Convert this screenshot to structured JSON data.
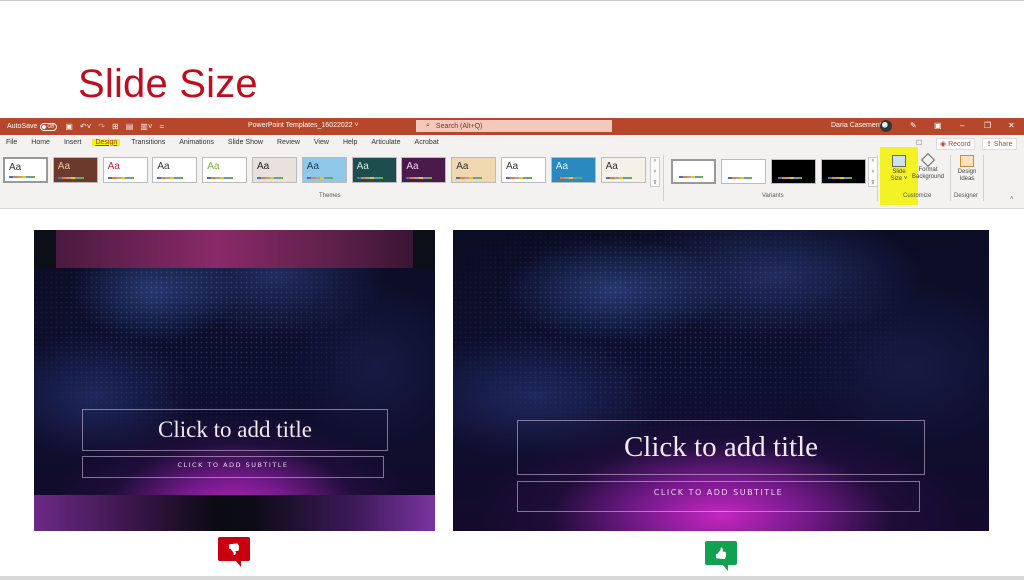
{
  "page": {
    "title": "Slide Size"
  },
  "powerpoint": {
    "titlebar": {
      "autosave_label": "AutoSave",
      "autosave_state": "Off",
      "document_title": "PowerPoint Templates_16022022",
      "search_placeholder": "Search (Alt+Q)",
      "user_name": "Daria Casement"
    },
    "tabs": [
      {
        "label": "File",
        "active": false
      },
      {
        "label": "Home",
        "active": false
      },
      {
        "label": "Insert",
        "active": false
      },
      {
        "label": "Design",
        "active": true
      },
      {
        "label": "Transitions",
        "active": false
      },
      {
        "label": "Animations",
        "active": false
      },
      {
        "label": "Slide Show",
        "active": false
      },
      {
        "label": "Review",
        "active": false
      },
      {
        "label": "View",
        "active": false
      },
      {
        "label": "Help",
        "active": false
      },
      {
        "label": "Articulate",
        "active": false
      },
      {
        "label": "Acrobat",
        "active": false
      }
    ],
    "record_label": "Record",
    "share_label": "Share",
    "groups": {
      "themes_label": "Themes",
      "variants_label": "Variants",
      "customize_label": "Customize",
      "designer_label": "Designer"
    },
    "themes": [
      {
        "aa": "Aa",
        "bg": "#ffffff",
        "fg": "#333333"
      },
      {
        "aa": "Aa",
        "bg": "#6b3a2c",
        "fg": "#e8c8a0"
      },
      {
        "aa": "Aa",
        "bg": "#ffffff",
        "fg": "#c8203a"
      },
      {
        "aa": "Aa",
        "bg": "#ffffff",
        "fg": "#333333"
      },
      {
        "aa": "Aa",
        "bg": "#ffffff",
        "fg": "#7ab33a"
      },
      {
        "aa": "Aa",
        "bg": "#e8e2de",
        "fg": "#222222"
      },
      {
        "aa": "Aa",
        "bg": "#8fc8e8",
        "fg": "#1a3a5a"
      },
      {
        "aa": "Aa",
        "bg": "#1e4d4d",
        "fg": "#c8e8e0"
      },
      {
        "aa": "Aa",
        "bg": "#4a1a4a",
        "fg": "#f0d0f0"
      },
      {
        "aa": "Aa",
        "bg": "#f0d8b0",
        "fg": "#333333"
      },
      {
        "aa": "Aa",
        "bg": "#ffffff",
        "fg": "#333333"
      },
      {
        "aa": "Aa",
        "bg": "#2a8ac0",
        "fg": "#e0f4ff"
      },
      {
        "aa": "Aa",
        "bg": "#f4f2e8",
        "fg": "#333333"
      }
    ],
    "variants": [
      {
        "bg": "#ffffff"
      },
      {
        "bg": "#ffffff"
      },
      {
        "bg": "#000000"
      },
      {
        "bg": "#000000"
      }
    ],
    "buttons": {
      "slide_size_line1": "Slide",
      "slide_size_line2": "Size ˅",
      "format_bg_line1": "Format",
      "format_bg_line2": "Background",
      "design_ideas_line1": "Design",
      "design_ideas_line2": "Ideas"
    },
    "highlight_color": "#f2f200"
  },
  "slides": {
    "standard_4x3": {
      "title_placeholder": "Click to add title",
      "subtitle_placeholder": "CLICK TO ADD SUBTITLE",
      "verdict": "thumbs-down",
      "verdict_color": "#c8000f"
    },
    "widescreen_16x9": {
      "title_placeholder": "Click to add title",
      "subtitle_placeholder": "CLICK TO ADD SUBTITLE",
      "verdict": "thumbs-up",
      "verdict_color": "#12a150"
    }
  },
  "icons": {
    "thumbs_down": "👎",
    "thumbs_up": "👍",
    "search": "⌕",
    "pen": "✎",
    "minimize": "–",
    "restore": "❐",
    "close": "✕",
    "record_dot": "◉",
    "share": "⇪",
    "comment": "☐"
  }
}
